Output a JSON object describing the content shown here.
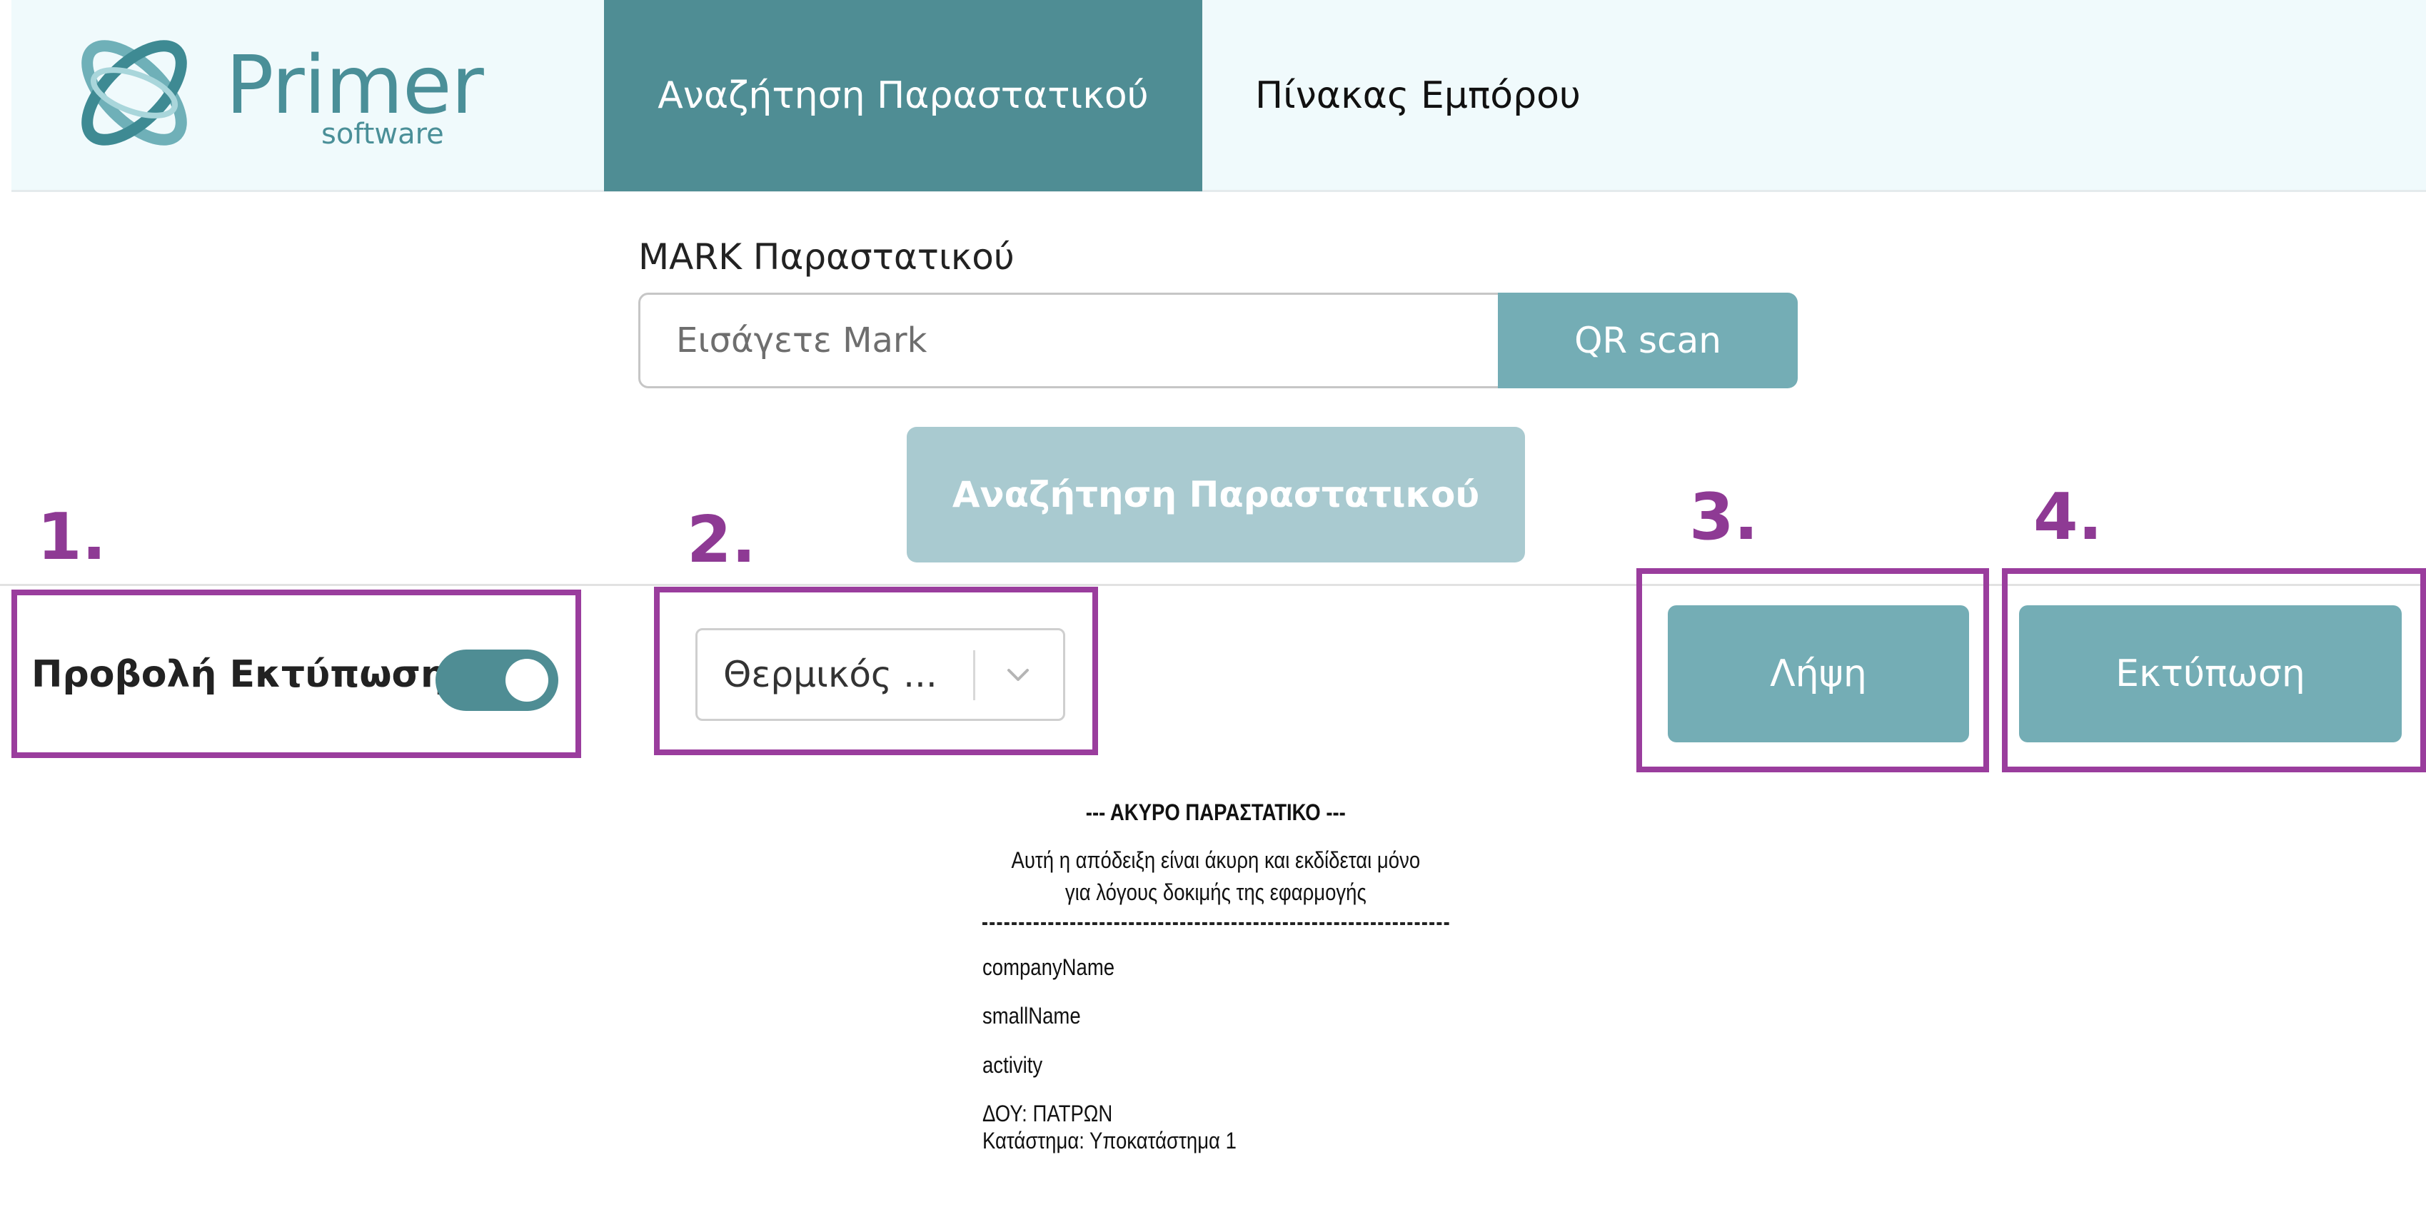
{
  "header": {
    "logo": {
      "name": "Primer",
      "sub": "software"
    },
    "tabs": [
      {
        "label": "Αναζήτηση Παραστατικού",
        "active": true
      },
      {
        "label": "Πίνακας Εμπόρου",
        "active": false
      }
    ]
  },
  "search": {
    "label": "MARK Παραστατικού",
    "placeholder": "Εισάγετε Mark",
    "value": "",
    "qr_label": "QR scan",
    "submit_label": "Αναζήτηση Παραστατικού"
  },
  "toolbar": {
    "toggle_label": "Προβολή Εκτύπωσης",
    "toggle_on": true,
    "printer_selected": "Θερμικός ...",
    "download_label": "Λήψη",
    "print_label": "Εκτύπωση"
  },
  "annotations": [
    "1.",
    "2.",
    "3.",
    "4."
  ],
  "receipt": {
    "title": "--- ΑΚΥΡΟ ΠΑΡΑΣΤΑΤΙΚΟ ---",
    "notice_line1": "Αυτή η απόδειξη είναι άκυρη και εκδίδεται μόνο",
    "notice_line2": "για λόγους δοκιμής της εφαρμογής",
    "company_name": "companyName",
    "small_name": "smallName",
    "activity": "activity",
    "doy": "ΔΟΥ: ΠΑΤΡΩΝ",
    "store": "Κατάστημα: Υποκατάστημα 1"
  },
  "colors": {
    "accent": "#4f8d94",
    "button": "#74adb5",
    "button_disabled": "#a9cad0",
    "annotation": "#9a3d9d",
    "header_bg": "#f0fafc"
  }
}
